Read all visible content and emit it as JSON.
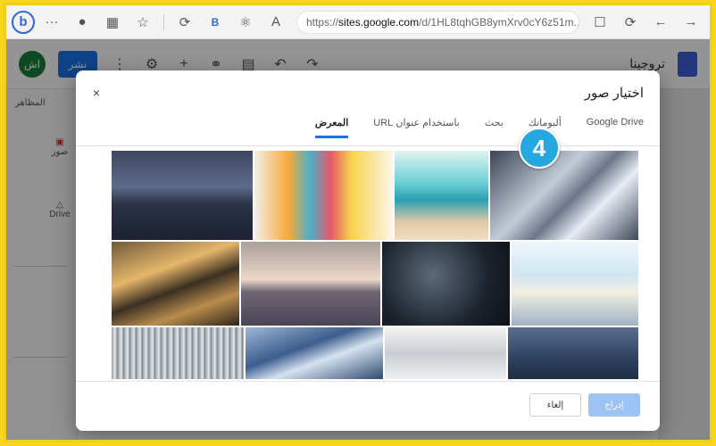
{
  "browser": {
    "brand_letter": "b",
    "menu_glyph": "···",
    "url_prefix": "https://",
    "url_host": "sites.google.com",
    "url_path": "/d/1HL8tqhGB8ymXrv0cY6z51m...",
    "reader_label": "A",
    "bing_letter": "B"
  },
  "app": {
    "avatar_initials": "اش",
    "publish_label": "نشر",
    "doc_title": "تروجينا",
    "side_heading": "المظاهر",
    "side_tile_upload": "صور",
    "side_tile_drive": "Drive"
  },
  "dialog": {
    "title": "اختيار صور",
    "close_glyph": "×",
    "tabs": [
      {
        "label": "المعرض",
        "active": true
      },
      {
        "label": "باستخدام عنوان URL",
        "active": false
      },
      {
        "label": "بحث",
        "active": false
      },
      {
        "label": "ألبوماتك",
        "active": false
      },
      {
        "label": "Google Drive",
        "active": false
      }
    ],
    "step_number": "4",
    "buttons": {
      "insert": "إدراج",
      "cancel": "إلغاء"
    }
  },
  "icons": [
    "close-icon",
    "settings-icon",
    "add-person-icon",
    "link-icon",
    "preview-icon",
    "undo-icon",
    "redo-icon",
    "more-vert-icon",
    "back-icon",
    "forward-icon",
    "refresh-icon"
  ]
}
